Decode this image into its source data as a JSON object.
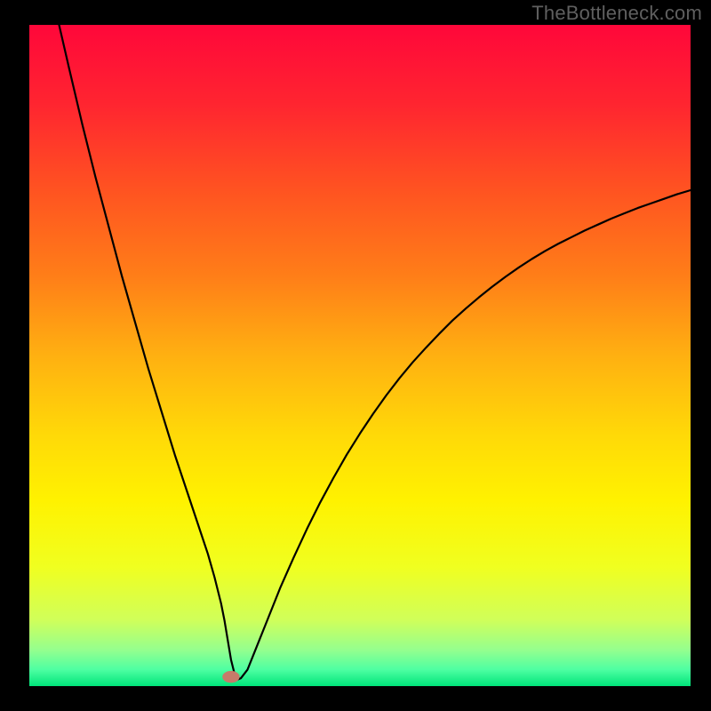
{
  "watermark": "TheBottleneck.com",
  "chart_data": {
    "type": "line",
    "title": "",
    "xlabel": "",
    "ylabel": "",
    "xlim": [
      0,
      100
    ],
    "ylim": [
      0,
      100
    ],
    "grid": false,
    "legend": false,
    "gradient_stops": [
      {
        "offset": 0.0,
        "color": "#ff073a"
      },
      {
        "offset": 0.12,
        "color": "#ff2530"
      },
      {
        "offset": 0.25,
        "color": "#ff5321"
      },
      {
        "offset": 0.38,
        "color": "#ff7e18"
      },
      {
        "offset": 0.5,
        "color": "#ffb011"
      },
      {
        "offset": 0.62,
        "color": "#ffd908"
      },
      {
        "offset": 0.72,
        "color": "#fff200"
      },
      {
        "offset": 0.82,
        "color": "#f0ff20"
      },
      {
        "offset": 0.9,
        "color": "#d0ff5a"
      },
      {
        "offset": 0.945,
        "color": "#95ff8e"
      },
      {
        "offset": 0.975,
        "color": "#4effa2"
      },
      {
        "offset": 1.0,
        "color": "#00e47a"
      }
    ],
    "marker": {
      "x": 30.5,
      "y": 1.4,
      "color": "#c77b6a",
      "rx": 1.3,
      "ry": 0.9
    },
    "series": [
      {
        "name": "bottleneck-curve",
        "color": "#000000",
        "stroke_width": 2.2,
        "x": [
          4.5,
          6,
          8,
          10,
          12,
          14,
          16,
          18,
          20,
          22,
          24,
          26,
          27,
          28,
          29,
          29.5,
          30,
          30.5,
          31,
          31.5,
          32,
          33,
          34,
          36,
          38,
          40,
          42,
          44,
          46,
          48,
          50,
          52,
          54,
          56,
          58,
          60,
          62,
          64,
          66,
          68,
          70,
          72,
          74,
          76,
          78,
          80,
          82,
          84,
          86,
          88,
          90,
          92,
          94,
          96,
          98,
          100
        ],
        "y": [
          100,
          93.5,
          85,
          77,
          69.5,
          62,
          55,
          48,
          41.5,
          35,
          29,
          23,
          20,
          16.5,
          12.5,
          10,
          7,
          4,
          2,
          1,
          1.2,
          2.5,
          5,
          10,
          15,
          19.5,
          23.8,
          27.8,
          31.5,
          35,
          38.2,
          41.2,
          44,
          46.6,
          49,
          51.2,
          53.3,
          55.3,
          57.1,
          58.8,
          60.4,
          61.9,
          63.3,
          64.6,
          65.8,
          66.9,
          67.9,
          68.9,
          69.8,
          70.7,
          71.5,
          72.3,
          73,
          73.7,
          74.4,
          75
        ]
      }
    ]
  }
}
